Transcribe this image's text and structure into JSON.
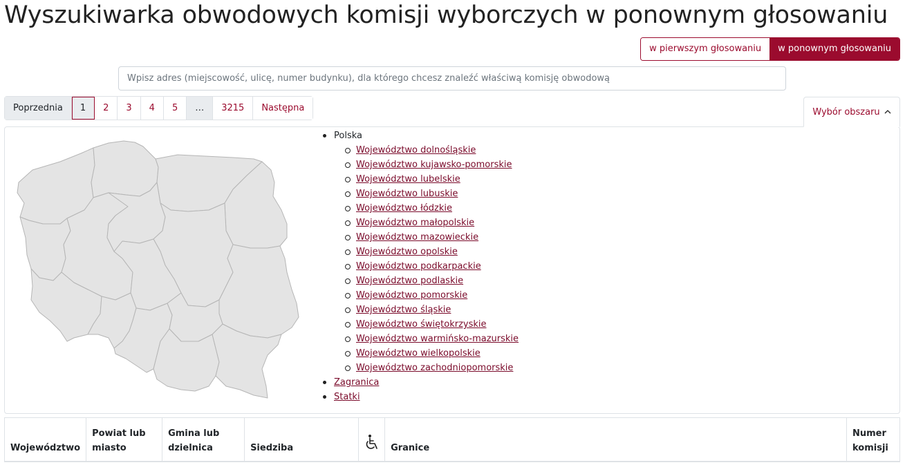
{
  "page": {
    "title": "Wyszukiwarka obwodowych komisji wyborczych w ponownym głosowaniu"
  },
  "round_toggle": {
    "first": "w pierwszym głosowaniu",
    "second": "w ponownym głosowaniu",
    "active": "second"
  },
  "search": {
    "placeholder": "Wpisz adres (miejscowość, ulicę, numer budynku), dla którego chcesz znaleźć właściwą komisję obwodową",
    "value": ""
  },
  "pagination": {
    "prev": "Poprzednia",
    "pages": [
      "1",
      "2",
      "3",
      "4",
      "5"
    ],
    "ellipsis": "…",
    "last": "3215",
    "next": "Następna",
    "current": "1"
  },
  "area_selector": {
    "label": "Wybór obszaru",
    "icon": "chevron-up-icon"
  },
  "tree": {
    "root": "Polska",
    "voivodeships": [
      "Województwo dolnośląskie",
      "Województwo kujawsko-pomorskie",
      "Województwo lubelskie",
      "Województwo lubuskie",
      "Województwo łódzkie",
      "Województwo małopolskie",
      "Województwo mazowieckie",
      "Województwo opolskie",
      "Województwo podkarpackie",
      "Województwo podlaskie",
      "Województwo pomorskie",
      "Województwo śląskie",
      "Województwo świętokrzyskie",
      "Województwo warmińsko-mazurskie",
      "Województwo wielkopolskie",
      "Województwo zachodniopomorskie"
    ],
    "other": [
      "Zagranica",
      "Statki"
    ]
  },
  "table": {
    "headers": {
      "voivodeship": "Województwo",
      "county": "Powiat lub miasto",
      "commune": "Gmina lub dzielnica",
      "seat": "Siedziba",
      "accessible_icon": "wheelchair-icon",
      "bounds": "Granice",
      "number": "Numer komisji"
    }
  },
  "colors": {
    "accent": "#9b0b2e",
    "link": "#7a0a2a",
    "map_fill": "#e4e4e4",
    "map_stroke": "#b5b5b5"
  }
}
